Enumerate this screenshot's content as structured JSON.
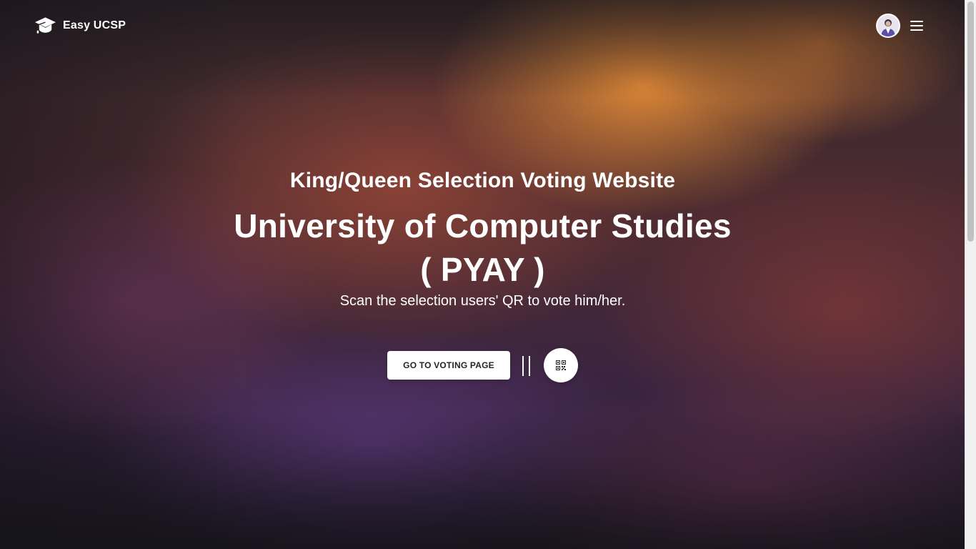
{
  "navbar": {
    "brand_name": "Easy UCSP",
    "brand_icon": "graduation-cap-icon",
    "menu_icon": "hamburger-menu-icon"
  },
  "hero": {
    "subtitle": "King/Queen Selection Voting Website",
    "title_line1": "University of Computer Studies",
    "title_line2": "( PYAY )",
    "lead": "Scan the selection users' QR to vote him/her.",
    "vote_button_label": "GO TO VOTING PAGE",
    "qr_button_icon": "qr-code-icon"
  },
  "colors": {
    "text": "#ffffff",
    "button_bg": "#ffffff",
    "button_text": "#212529"
  }
}
